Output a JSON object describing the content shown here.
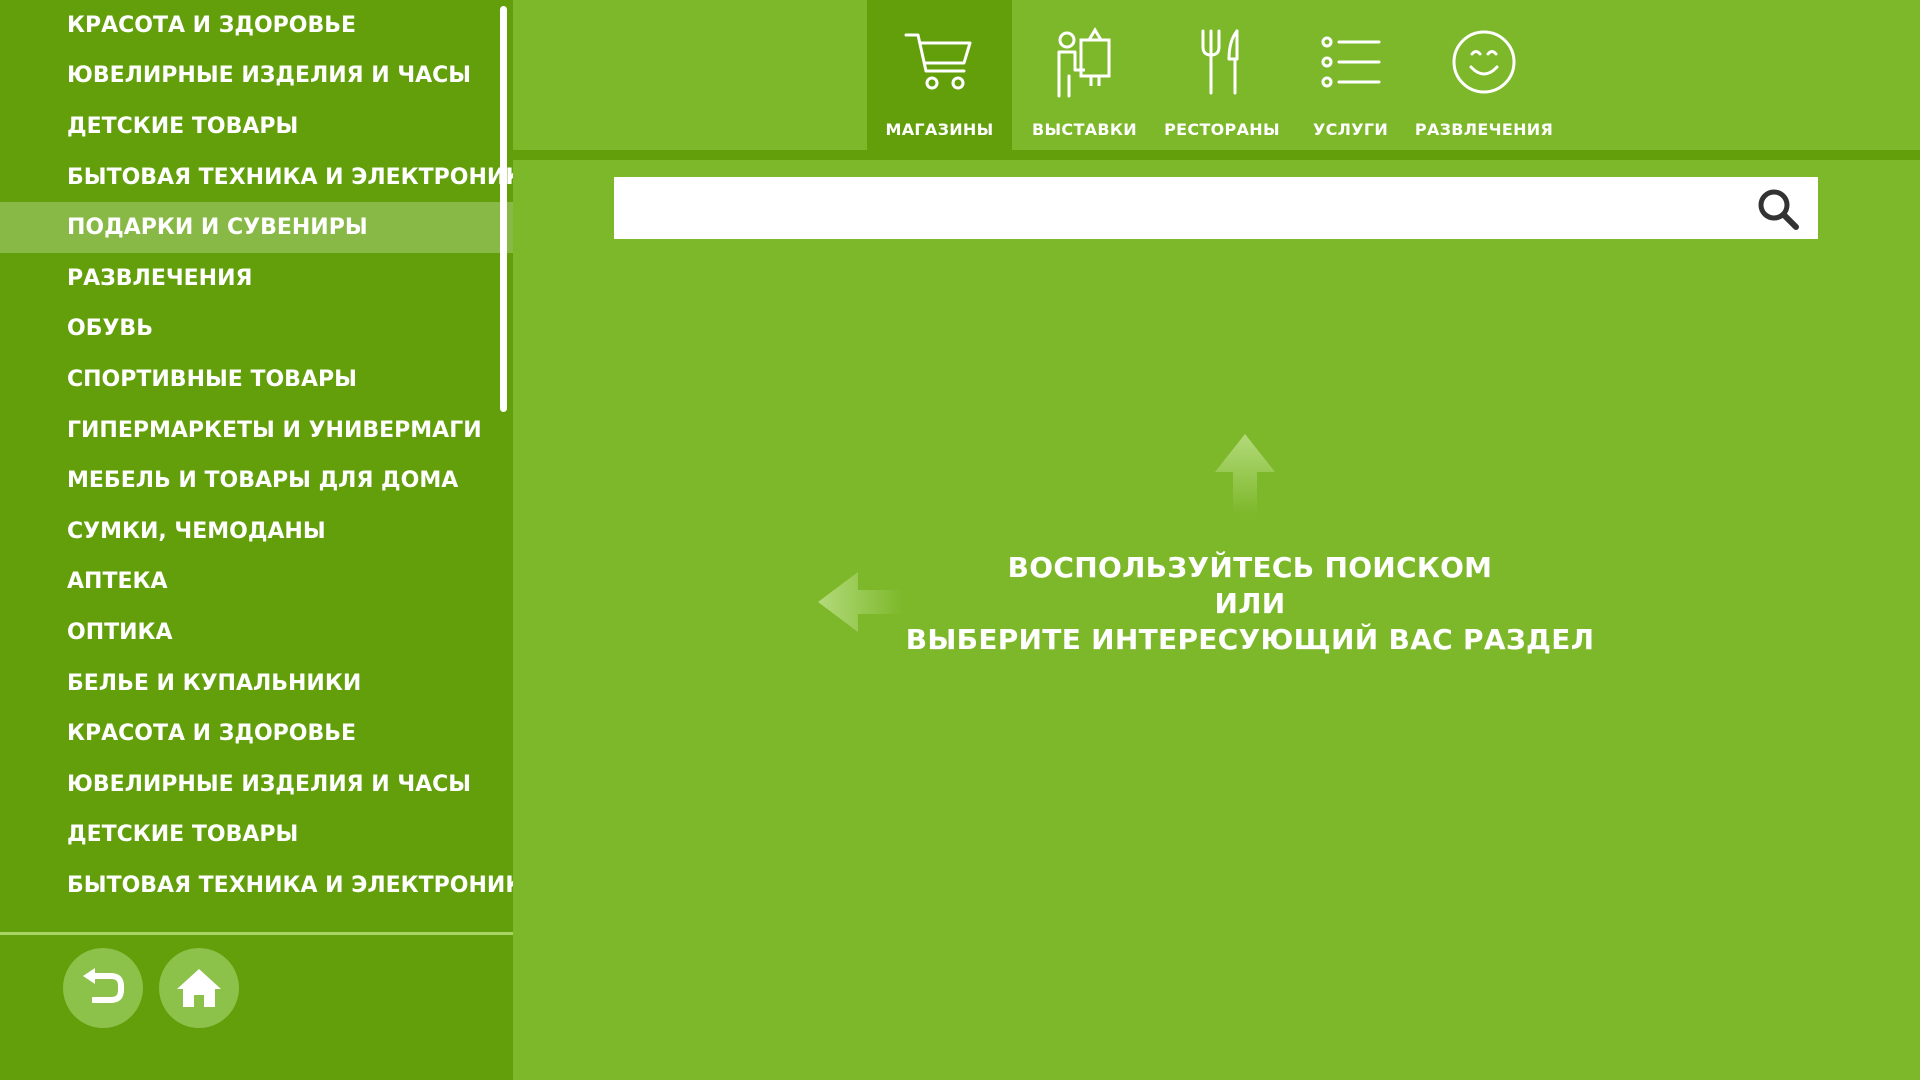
{
  "sidebar": {
    "items": [
      {
        "label": "КРАСОТА И ЗДОРОВЬЕ"
      },
      {
        "label": "ЮВЕЛИРНЫЕ ИЗДЕЛИЯ И ЧАСЫ"
      },
      {
        "label": "ДЕТСКИЕ ТОВАРЫ"
      },
      {
        "label": "БЫТОВАЯ ТЕХНИКА И ЭЛЕКТРОНИКА"
      },
      {
        "label": "ПОДАРКИ И СУВЕНИРЫ"
      },
      {
        "label": "РАЗВЛЕЧЕНИЯ"
      },
      {
        "label": "ОБУВЬ"
      },
      {
        "label": "СПОРТИВНЫЕ ТОВАРЫ"
      },
      {
        "label": "ГИПЕРМАРКЕТЫ И УНИВЕРМАГИ"
      },
      {
        "label": "МЕБЕЛЬ И ТОВАРЫ ДЛЯ ДОМА"
      },
      {
        "label": "СУМКИ, ЧЕМОДАНЫ"
      },
      {
        "label": "АПТЕКА"
      },
      {
        "label": "ОПТИКА"
      },
      {
        "label": "БЕЛЬЕ И КУПАЛЬНИКИ"
      },
      {
        "label": "КРАСОТА И ЗДОРОВЬЕ"
      },
      {
        "label": "ЮВЕЛИРНЫЕ ИЗДЕЛИЯ И ЧАСЫ"
      },
      {
        "label": "ДЕТСКИЕ ТОВАРЫ"
      },
      {
        "label": "БЫТОВАЯ ТЕХНИКА И ЭЛЕКТРОНИКА"
      }
    ],
    "selected_item": "ПОДАРКИ И СУВЕНИРЫ",
    "buttons": {
      "back_icon": "back-arrow-icon",
      "home_icon": "home-icon"
    }
  },
  "nav": {
    "tabs": [
      {
        "label": "МАГАЗИНЫ",
        "icon": "cart-icon",
        "active": true
      },
      {
        "label": "ВЫСТАВКИ",
        "icon": "exhibition-icon",
        "active": false
      },
      {
        "label": "РЕСТОРАНЫ",
        "icon": "fork-knife-icon",
        "active": false
      },
      {
        "label": "УСЛУГИ",
        "icon": "list-icon",
        "active": false
      },
      {
        "label": "РАЗВЛЕЧЕНИЯ",
        "icon": "smiley-icon",
        "active": false
      }
    ]
  },
  "search": {
    "value": "",
    "placeholder": "",
    "icon": "search-icon"
  },
  "hint": {
    "line1": "ВОСПОЛЬЗУЙТЕСЬ ПОИСКОМ",
    "line2": "ИЛИ",
    "line3": "ВЫБЕРИТЕ ИНТЕРЕСУЮЩИЙ ВАС РАЗДЕЛ"
  },
  "colors": {
    "background": "#7db82b",
    "sidebar": "#629f0b",
    "selected_item": "#88b845",
    "button": "#8cc14a",
    "text": "#ffffff"
  }
}
